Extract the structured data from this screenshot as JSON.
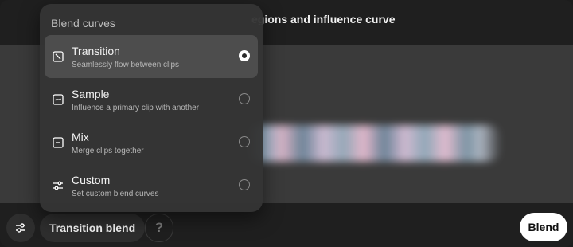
{
  "header": {
    "title_visible_fragment": "egions and influence curve"
  },
  "menu": {
    "title": "Blend curves",
    "items": [
      {
        "label": "Transition",
        "description": "Seamlessly flow between clips",
        "icon": "transition-icon",
        "selected": true
      },
      {
        "label": "Sample",
        "description": "Influence a primary clip with another",
        "icon": "sample-icon",
        "selected": false
      },
      {
        "label": "Mix",
        "description": "Merge clips together",
        "icon": "mix-icon",
        "selected": false
      },
      {
        "label": "Custom",
        "description": "Set custom blend curves",
        "icon": "sliders-icon",
        "selected": false
      }
    ]
  },
  "toolbar": {
    "settings_icon": "sliders-icon",
    "current_blend_label": "Transition blend",
    "help_label": "?",
    "blend_button_label": "Blend"
  },
  "colors": {
    "background": "#1f1f1f",
    "timeline": "#3a3a3a",
    "menu_bg": "#343434",
    "selected_item_bg": "#4d4d4d",
    "primary_button_bg": "#ffffff"
  }
}
